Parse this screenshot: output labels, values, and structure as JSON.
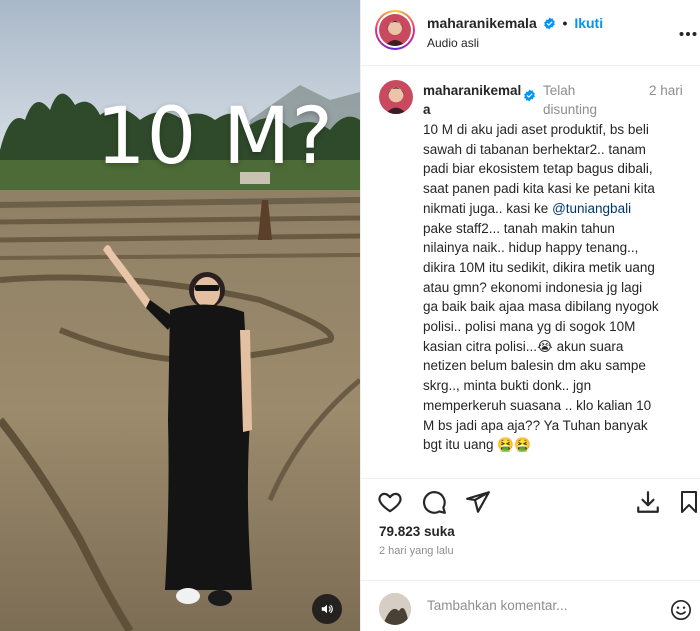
{
  "media": {
    "overlay_text": "10 M?",
    "audio_button_icon": "speaker-icon"
  },
  "header": {
    "username": "maharanikemala",
    "separator": "•",
    "follow_label": "Ikuti",
    "audio_label": "Audio asli",
    "more_label": "..."
  },
  "caption": {
    "username": "maharanikemala",
    "edited_label": "Telah disunting",
    "time": "2 hari",
    "lines": [
      "10 M di aku jadi aset produktif, bs beli",
      "sawah di tabanan berhektar2.. tanam",
      "padi biar ekosistem tetap bagus dibali,",
      "saat panen padi kita kasi ke petani kita",
      "nikmati juga.. kasi ke ",
      "pake staff2... tanah makin tahun",
      "nilainya naik.. hidup happy tenang..,",
      "dikira 10M itu sedikit, dikira metik uang",
      "atau gmn? ekonomi indonesia jg lagi",
      "ga baik baik ajaa masa dibilang nyogok",
      "polisi.. polisi mana yg di sogok 10M",
      "kasian citra polisi...",
      " akun suara",
      "netizen belum balesin dm aku sampe",
      "skrg.., minta bukti donk.. jgn",
      "memperkeruh suasana .. klo kalian 10",
      "M bs jadi apa aja?? Ya Tuhan banyak",
      "bgt itu uang "
    ],
    "mention": "@tuniangbali",
    "emoji_crying": "😭",
    "emoji_sick": "🤮🤮"
  },
  "actions": {
    "like_icon": "heart-icon",
    "comment_icon": "comment-icon",
    "share_icon": "send-icon",
    "download_icon": "download-icon",
    "save_icon": "bookmark-icon"
  },
  "likes": "79.823 suka",
  "posted_ago": "2 hari yang lalu",
  "comment": {
    "placeholder": "Tambahkan komentar...",
    "emoji_icon": "smiley-icon"
  },
  "colors": {
    "accent": "#0095f6",
    "mention": "#00376b",
    "muted": "#8e8e8e",
    "verified": "#0095f6"
  }
}
